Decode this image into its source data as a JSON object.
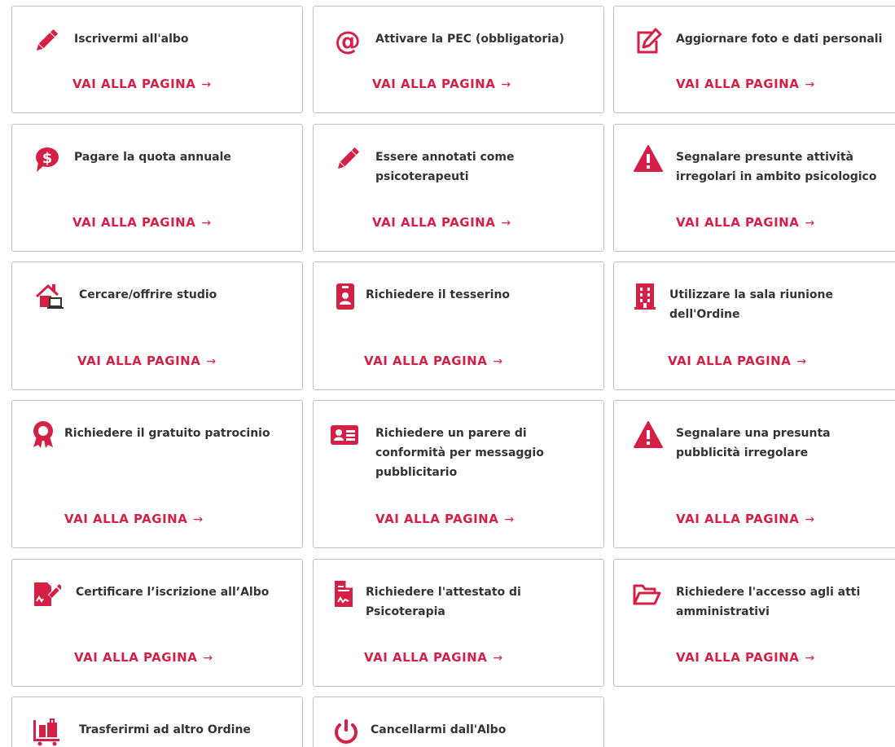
{
  "accent_color": "#d41f46",
  "text_color": "#333333",
  "cta_label": "VAI ALLA PAGINA",
  "cta_arrow": "→",
  "cards": [
    {
      "title": "Iscrivermi all'albo",
      "icon": "pencil-icon"
    },
    {
      "title": "Attivare la PEC (obbligatoria)",
      "icon": "at-sign-icon"
    },
    {
      "title": "Aggiornare foto e dati personali",
      "icon": "edit-square-icon"
    },
    {
      "title": "Pagare la quota annuale",
      "icon": "dollar-speech-bubble-icon"
    },
    {
      "title": "Essere annotati come psicoterapeuti",
      "icon": "pencil-icon"
    },
    {
      "title": "Segnalare presunte attività irregolari in ambito psicologico",
      "icon": "warning-triangle-icon"
    },
    {
      "title": "Cercare/offrire studio",
      "icon": "house-laptop-icon"
    },
    {
      "title": "Richiedere il tesserino",
      "icon": "id-badge-icon"
    },
    {
      "title": "Utilizzare la sala riunione dell'Ordine",
      "icon": "building-icon"
    },
    {
      "title": "Richiedere il gratuito patrocinio",
      "icon": "award-ribbon-icon"
    },
    {
      "title": "Richiedere un parere di conformità per messaggio pubblicitario",
      "icon": "id-card-icon"
    },
    {
      "title": "Segnalare una presunta pubblicità irregolare",
      "icon": "warning-triangle-icon"
    },
    {
      "title": "Certificare l’iscrizione all’Albo",
      "icon": "signed-document-icon"
    },
    {
      "title": "Richiedere l'attestato di Psicoterapia",
      "icon": "file-signature-icon"
    },
    {
      "title": "Richiedere l'accesso agli atti amministrativi",
      "icon": "open-folder-icon"
    },
    {
      "title": "Trasferirmi ad altro Ordine",
      "icon": "luggage-cart-icon"
    },
    {
      "title": "Cancellarmi dall'Albo",
      "icon": "power-icon"
    }
  ]
}
